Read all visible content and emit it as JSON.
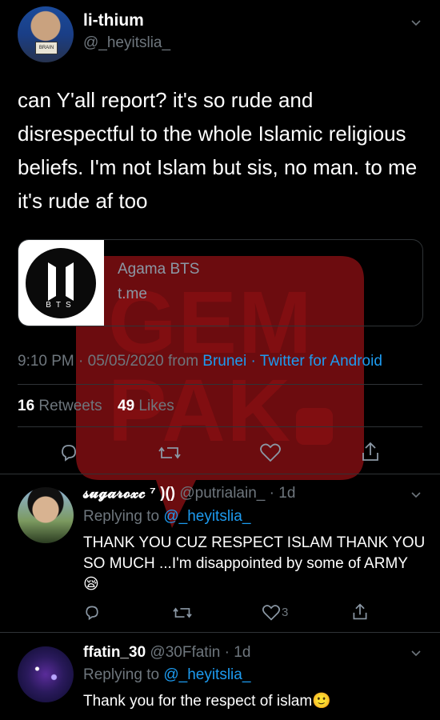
{
  "tweet": {
    "display_name": "li-thium",
    "handle": "@_heyitslia_",
    "avatar_badge": "BRAIN",
    "text": "can Y'all report? it's so rude and disrespectful to the whole Islamic religious beliefs. I'm not Islam but sis, no man. to me it's rude af too",
    "card": {
      "logo_text": "BTS",
      "title": "Agama BTS",
      "domain": "t.me"
    },
    "meta_time_date": "9:10 PM · 05/05/2020 from ",
    "meta_location": "Brunei",
    "meta_sep": " · ",
    "meta_source": "Twitter for Android",
    "retweets_count": "16",
    "retweets_label": "Retweets",
    "likes_count": "49",
    "likes_label": "Likes"
  },
  "watermark": {
    "line1": "GEM",
    "line2": "PAK",
    "color": "#c4161c"
  },
  "replies": [
    {
      "display_name": "𝓼𝓾𝓰𝓪𝓻𝓸𝔁𝓬 ⁷ )()",
      "handle": "@putrialain_",
      "age": "· 1d",
      "replying_label": "Replying to ",
      "replying_to": "@_heyitslia_",
      "text": "THANK YOU CUZ RESPECT ISLAM THANK YOU SO MUCH ...I'm disappointed by some of ARMY 😪",
      "like_count": "3"
    },
    {
      "display_name": "ffatin_30",
      "handle": "@30Ffatin",
      "age": "· 1d",
      "replying_label": "Replying to ",
      "replying_to": "@_heyitslia_",
      "text": "Thank you for the respect of islam🙂"
    }
  ]
}
